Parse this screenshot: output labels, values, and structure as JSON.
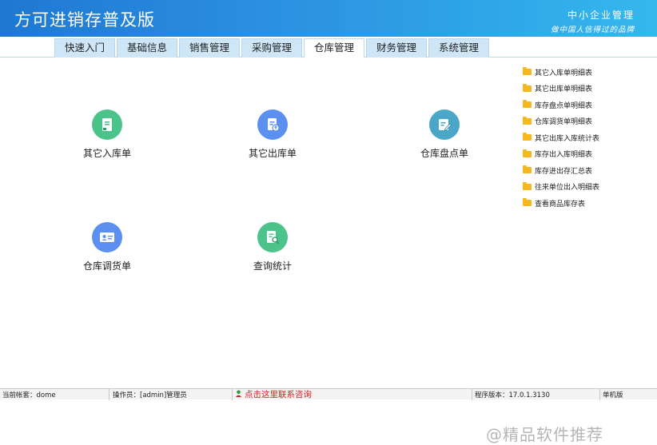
{
  "header": {
    "title": "方可进销存普及版",
    "brand_main": "中小企业管理",
    "brand_sub": "做中国人信得过的品牌"
  },
  "tabs": [
    {
      "label": "快速入门",
      "active": false
    },
    {
      "label": "基础信息",
      "active": false
    },
    {
      "label": "销售管理",
      "active": false
    },
    {
      "label": "采购管理",
      "active": false
    },
    {
      "label": "仓库管理",
      "active": true
    },
    {
      "label": "财务管理",
      "active": false
    },
    {
      "label": "系统管理",
      "active": false
    }
  ],
  "modules": [
    {
      "label": "其它入库单",
      "icon": "document-in-icon",
      "color": "#4cc38a"
    },
    {
      "label": "其它出库单",
      "icon": "document-out-icon",
      "color": "#5b8ff0"
    },
    {
      "label": "仓库盘点单",
      "icon": "edit-document-icon",
      "color": "#4aa7c8"
    },
    {
      "label": "仓库调货单",
      "icon": "id-card-icon",
      "color": "#5b8ff0"
    },
    {
      "label": "查询统计",
      "icon": "search-report-icon",
      "color": "#4cc38a"
    }
  ],
  "reports": [
    "其它入库单明细表",
    "其它出库单明细表",
    "库存盘点单明细表",
    "仓库调货单明细表",
    "其它出库入库统计表",
    "库存出入库明细表",
    "库存进出存汇总表",
    "往来单位出入明细表",
    "查看商品库存表"
  ],
  "status": {
    "account": "当前帐套：dome",
    "operator": "操作员：[admin]管理员",
    "contact": "点击这里联系咨询",
    "version": "程序版本：17.0.1.3130",
    "edition": "单机版"
  },
  "watermark": "@精品软件推荐"
}
